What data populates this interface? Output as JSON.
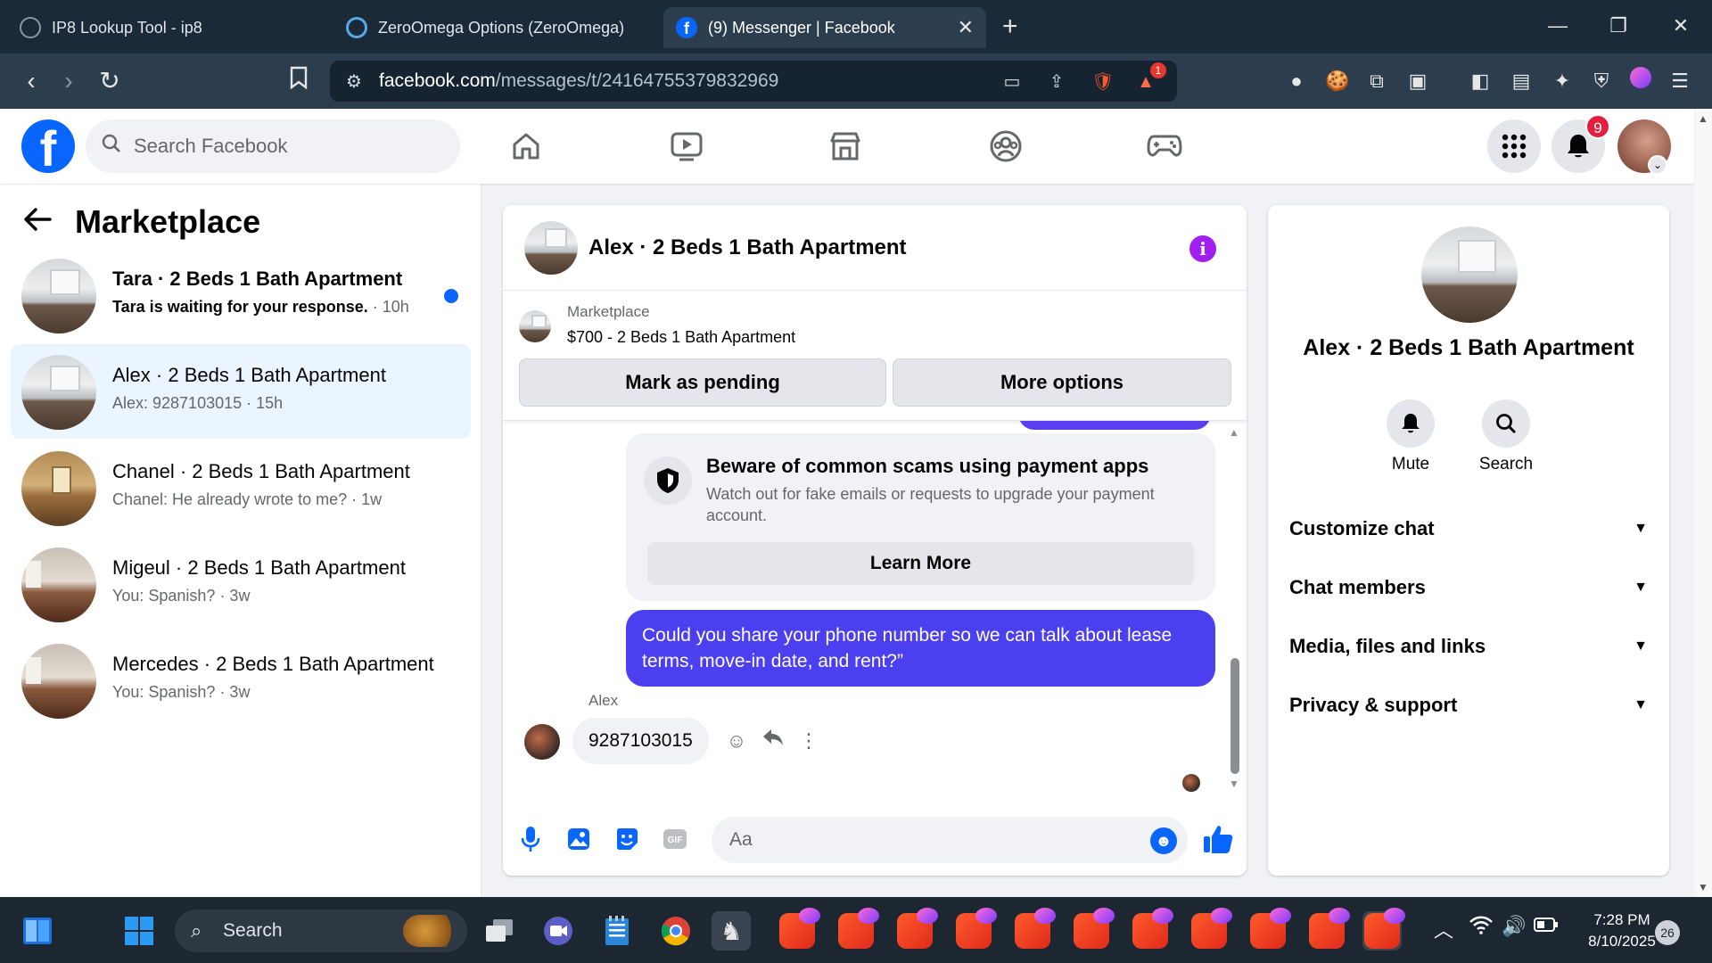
{
  "browser": {
    "tabs": [
      {
        "title": "IP8 Lookup Tool - ip8",
        "active": false
      },
      {
        "title": "ZeroOmega Options (ZeroOmega)",
        "active": false
      },
      {
        "title": "(9) Messenger | Facebook",
        "active": true
      }
    ],
    "url_domain": "facebook.com",
    "url_path": "/messages/t/24164755379832969",
    "shields_badge": "1"
  },
  "fb": {
    "search_placeholder": "Search Facebook",
    "notifications_count": "9",
    "logo_letter": "f"
  },
  "sidebar": {
    "title": "Marketplace",
    "conversations": [
      {
        "title": "Tara · 2 Beds 1 Bath Apartment",
        "preview": "Tara is waiting for your response.",
        "time": " · 10h",
        "unread": true,
        "selected": false
      },
      {
        "title": "Alex · 2 Beds 1 Bath Apartment",
        "preview": "Alex: 9287103015",
        "time": " · 15h",
        "unread": false,
        "selected": true
      },
      {
        "title": "Chanel · 2 Beds 1 Bath Apartment",
        "preview": "Chanel: He already wrote to me?",
        "time": " · 1w",
        "unread": false,
        "selected": false
      },
      {
        "title": "Migeul · 2 Beds 1 Bath Apartment",
        "preview": "You: Spanish?",
        "time": " · 3w",
        "unread": false,
        "selected": false
      },
      {
        "title": "Mercedes · 2 Beds 1 Bath Apartment",
        "preview": "You: Spanish?",
        "time": " · 3w",
        "unread": false,
        "selected": false
      }
    ]
  },
  "chat": {
    "title": "Alex · 2 Beds 1 Bath Apartment",
    "marketplace_label": "Marketplace",
    "listing": "$700 - 2 Beds 1 Bath Apartment",
    "mark_pending_label": "Mark as pending",
    "more_options_label": "More options",
    "scam_title": "Beware of common scams using payment apps",
    "scam_text": "Watch out for fake emails or requests to upgrade your payment account.",
    "learn_more_label": "Learn More",
    "my_message": "Could you share your phone number so we can talk about lease terms, move-in date, and rent?”",
    "sender_name": "Alex",
    "their_message": "9287103015",
    "composer_placeholder": "Aa"
  },
  "info": {
    "name": "Alex · 2 Beds 1 Bath Apartment",
    "mute_label": "Mute",
    "search_label": "Search",
    "sections": [
      "Customize chat",
      "Chat members",
      "Media, files and links",
      "Privacy & support"
    ]
  },
  "taskbar": {
    "search_label": "Search",
    "time": "7:28 PM",
    "date": "8/10/2025",
    "notification_count": "26"
  },
  "colors": {
    "fb_blue": "#0866ff",
    "message_purple": "#4c3ff0",
    "info_icon": "#a020f0",
    "badge_red": "#e41e3f"
  }
}
